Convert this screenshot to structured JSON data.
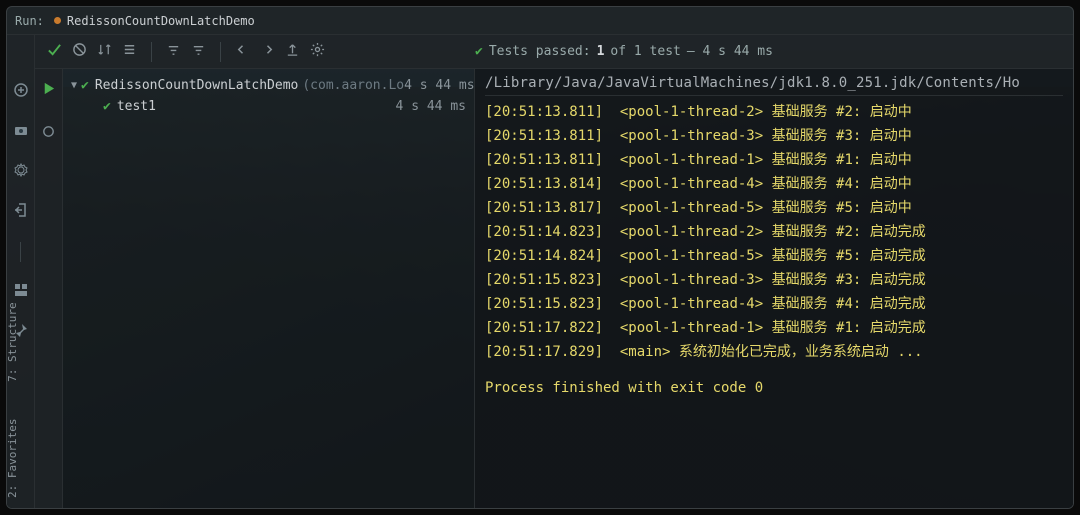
{
  "topbar": {
    "label": "Run:",
    "title": "RedissonCountDownLatchDemo"
  },
  "status": {
    "prefix": "Tests passed:",
    "count": "1",
    "of": "of 1 test",
    "time": "– 4 s 44 ms"
  },
  "tree": {
    "root": {
      "name": "RedissonCountDownLatchDemo",
      "meta": "(com.aaron.Lo",
      "time": "4 s 44 ms"
    },
    "child": {
      "name": "test1",
      "time": "4 s 44 ms"
    }
  },
  "console": {
    "path": "/Library/Java/JavaVirtualMachines/jdk1.8.0_251.jdk/Contents/Ho",
    "lines": [
      {
        "ts": "[20:51:13.811]",
        "thr": "<pool-1-thread-2>",
        "msg": "基础服务 #2: 启动中"
      },
      {
        "ts": "[20:51:13.811]",
        "thr": "<pool-1-thread-3>",
        "msg": "基础服务 #3: 启动中"
      },
      {
        "ts": "[20:51:13.811]",
        "thr": "<pool-1-thread-1>",
        "msg": "基础服务 #1: 启动中"
      },
      {
        "ts": "[20:51:13.814]",
        "thr": "<pool-1-thread-4>",
        "msg": "基础服务 #4: 启动中"
      },
      {
        "ts": "[20:51:13.817]",
        "thr": "<pool-1-thread-5>",
        "msg": "基础服务 #5: 启动中"
      },
      {
        "ts": "[20:51:14.823]",
        "thr": "<pool-1-thread-2>",
        "msg": "基础服务 #2: 启动完成"
      },
      {
        "ts": "[20:51:14.824]",
        "thr": "<pool-1-thread-5>",
        "msg": "基础服务 #5: 启动完成"
      },
      {
        "ts": "[20:51:15.823]",
        "thr": "<pool-1-thread-3>",
        "msg": "基础服务 #3: 启动完成"
      },
      {
        "ts": "[20:51:15.823]",
        "thr": "<pool-1-thread-4>",
        "msg": "基础服务 #4: 启动完成"
      },
      {
        "ts": "[20:51:17.822]",
        "thr": "<pool-1-thread-1>",
        "msg": "基础服务 #1: 启动完成"
      },
      {
        "ts": "[20:51:17.829]",
        "thr": "<main>",
        "msg": "系统初始化已完成，业务系统启动 ..."
      }
    ],
    "exit": "Process finished with exit code 0"
  },
  "sidetabs": {
    "structure": "7: Structure",
    "favorites": "2: Favorites"
  }
}
